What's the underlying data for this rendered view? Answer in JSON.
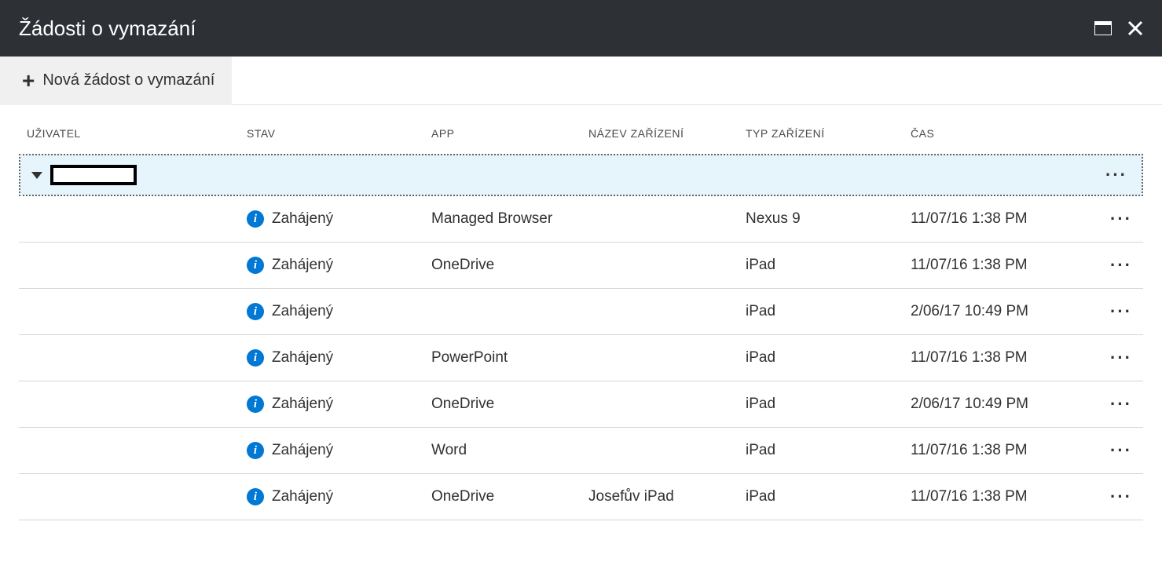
{
  "header": {
    "title": "Žádosti o vymazání"
  },
  "toolbar": {
    "new_request": "Nová žádost o vymazání"
  },
  "table": {
    "columns": {
      "user": "UŽIVATEL",
      "status": "STAV",
      "app": "APP",
      "device_name": "NÁZEV ZAŘÍZENÍ",
      "device_type": "TYP ZAŘÍZENÍ",
      "time": "ČAS"
    },
    "rows": [
      {
        "status": "Zahájený",
        "app": "Managed Browser",
        "device_name": "",
        "device_type": "Nexus 9",
        "time": "11/07/16 1:38 PM"
      },
      {
        "status": "Zahájený",
        "app": "OneDrive",
        "device_name": "",
        "device_type": "iPad",
        "time": "11/07/16 1:38 PM"
      },
      {
        "status": "Zahájený",
        "app": "",
        "device_name": "",
        "device_type": "iPad",
        "time": "2/06/17 10:49 PM"
      },
      {
        "status": "Zahájený",
        "app": "PowerPoint",
        "device_name": "",
        "device_type": "iPad",
        "time": "11/07/16 1:38 PM"
      },
      {
        "status": "Zahájený",
        "app": "OneDrive",
        "device_name": "",
        "device_type": "iPad",
        "time": "2/06/17 10:49 PM"
      },
      {
        "status": "Zahájený",
        "app": "Word",
        "device_name": "",
        "device_type": "iPad",
        "time": "11/07/16 1:38 PM"
      },
      {
        "status": "Zahájený",
        "app": "OneDrive",
        "device_name": "Josefův iPad",
        "device_type": "iPad",
        "time": "11/07/16 1:38 PM"
      }
    ]
  }
}
